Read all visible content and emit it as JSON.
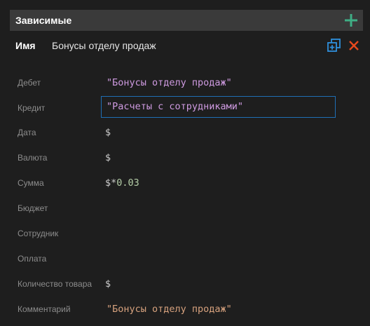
{
  "header": {
    "title": "Зависимые"
  },
  "name_row": {
    "label": "Имя",
    "value": "Бонусы отделу продаж"
  },
  "fields": [
    {
      "label": "Дебет",
      "value": "\"Бонусы отделу продаж\""
    },
    {
      "label": "Кредит",
      "value": "\"Расчеты с сотрудниками\""
    },
    {
      "label": "Дата",
      "value": "$"
    },
    {
      "label": "Валюта",
      "value": "$"
    },
    {
      "label": "Сумма",
      "value_prefix": "$",
      "value_op": "*",
      "value_number": "0.03"
    },
    {
      "label": "Бюджет",
      "value": ""
    },
    {
      "label": "Сотрудник",
      "value": ""
    },
    {
      "label": "Оплата",
      "value": ""
    },
    {
      "label": "Количество товара",
      "value": "$"
    },
    {
      "label": "Комментарий",
      "value": "\"Бонусы отделу продаж\""
    }
  ],
  "colors": {
    "accent_add": "#3fae85",
    "accent_close": "#e8491d",
    "accent_copy": "#2f8fdc",
    "input_border": "#1f6fb5",
    "string": "#ce9ae0",
    "comment_string": "#d7a27e",
    "number": "#b5cea8"
  },
  "icons": {
    "add": "plus-icon",
    "copy": "duplicate-icon",
    "close": "close-icon"
  }
}
